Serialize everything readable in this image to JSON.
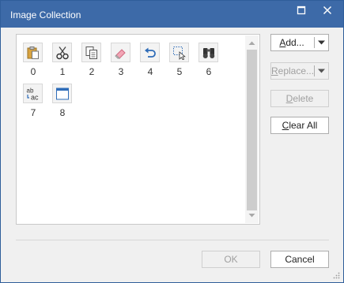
{
  "window": {
    "title": "Image Collection"
  },
  "titlebar": {
    "maximize_icon": "maximize-icon",
    "close_icon": "close-icon"
  },
  "images": [
    {
      "index": "0",
      "icon": "paste-icon"
    },
    {
      "index": "1",
      "icon": "cut-icon"
    },
    {
      "index": "2",
      "icon": "copy-icon"
    },
    {
      "index": "3",
      "icon": "eraser-icon"
    },
    {
      "index": "4",
      "icon": "undo-icon"
    },
    {
      "index": "5",
      "icon": "select-icon"
    },
    {
      "index": "6",
      "icon": "find-icon"
    },
    {
      "index": "7",
      "icon": "replace-text-icon"
    },
    {
      "index": "8",
      "icon": "window-icon"
    }
  ],
  "buttons": {
    "add": {
      "mnemonic": "A",
      "rest": "dd..."
    },
    "replace": {
      "mnemonic": "R",
      "rest": "eplace..."
    },
    "delete": {
      "mnemonic": "D",
      "rest": "elete"
    },
    "clear_all": {
      "mnemonic": "C",
      "rest": "lear All"
    },
    "ok": "OK",
    "cancel": "Cancel"
  },
  "colors": {
    "titlebar": "#3d6aa8",
    "icon_accent": "#2e6cb8"
  }
}
